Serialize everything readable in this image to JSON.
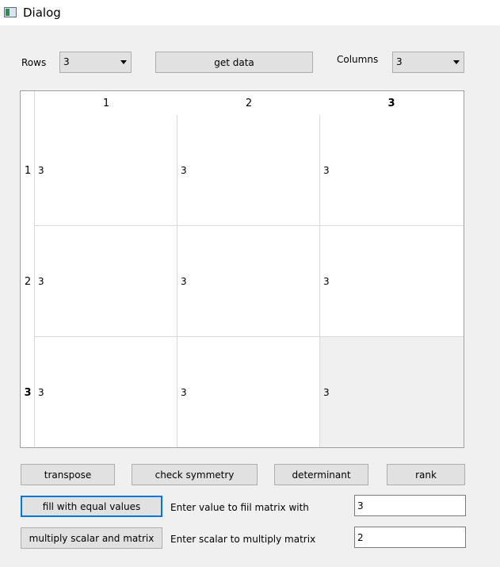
{
  "window": {
    "title": "Dialog",
    "icon": "app-window-icon"
  },
  "controls": {
    "rows_label": "Rows",
    "rows_value": "3",
    "get_data_label": "get data",
    "columns_label": "Columns",
    "columns_value": "3"
  },
  "table": {
    "column_headers": [
      "1",
      "2",
      "3"
    ],
    "row_headers": [
      "1",
      "2",
      "3"
    ],
    "rows": [
      [
        "3",
        "3",
        "3"
      ],
      [
        "3",
        "3",
        "3"
      ],
      [
        "3",
        "3",
        "3"
      ]
    ],
    "current_cell": {
      "row": 3,
      "column": 3
    }
  },
  "actions": {
    "transpose": "transpose",
    "check_symmetry": "check symmetry",
    "determinant": "determinant",
    "rank": "rank",
    "fill_equal": "fill with equal values",
    "fill_prompt": "Enter value to fiil matrix with",
    "fill_value": "3",
    "multiply": "multiply scalar and matrix",
    "scalar_prompt": "Enter scalar to multiply matrix",
    "scalar_value": "2"
  }
}
